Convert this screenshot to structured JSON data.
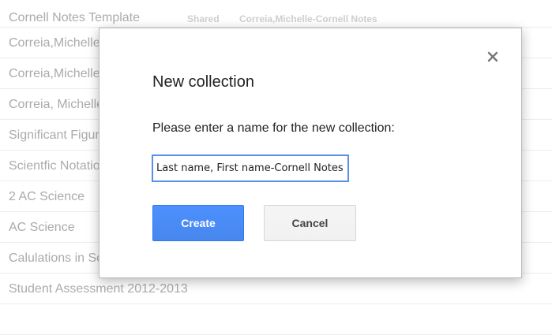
{
  "documents": [
    {
      "title": "Cornell Notes Template",
      "shared": "Shared",
      "owner": "Correia,Michelle-Cornell Notes"
    },
    {
      "title": "Correia,Michelle-Cornell Notes"
    },
    {
      "title": "Correia,Michelle-Cornell Notes"
    },
    {
      "title": "Correia, Michelle-Cornell Notes"
    },
    {
      "title": "Significant Figures"
    },
    {
      "title": "Scientfic Notation"
    },
    {
      "title": "2 AC Science"
    },
    {
      "title": "AC Science"
    },
    {
      "title": "Calulations in Scientific Notation"
    },
    {
      "title": "Student Assessment 2012-2013"
    },
    {
      "title": ""
    }
  ],
  "dialog": {
    "title": "New collection",
    "prompt": "Please enter a name for the new collection:",
    "input_value": "Last name, First name-Cornell Notes",
    "create_label": "Create",
    "cancel_label": "Cancel",
    "close_icon": "close-icon"
  },
  "colors": {
    "primary_button": "#4d90fe",
    "focus_ring": "#5b8fe6"
  }
}
